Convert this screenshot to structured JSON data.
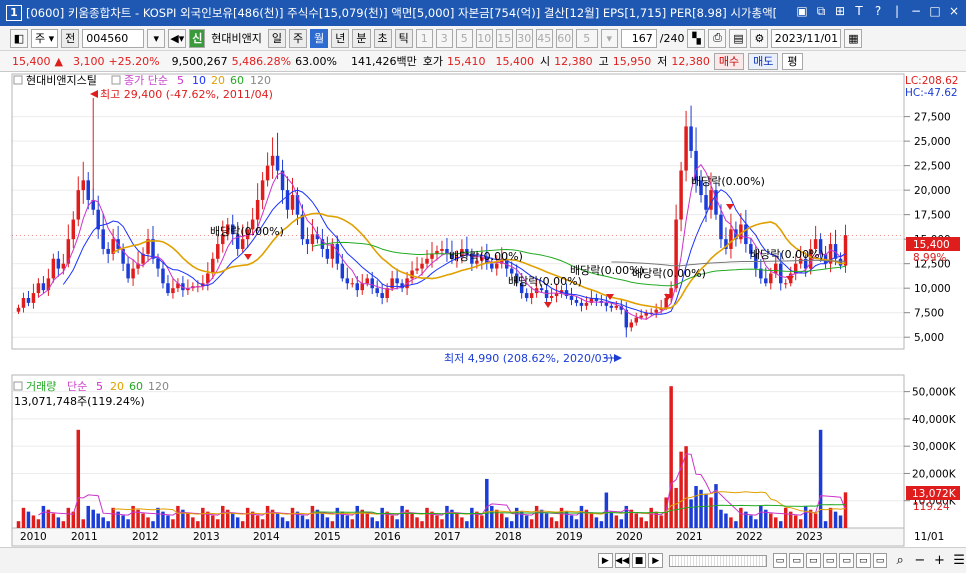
{
  "titlebar": {
    "num": "1",
    "text": "[0600] 키움종합차트 - KOSPI 외국인보유[486(천)] 주식수[15,079(천)] 액면[5,000] 자본금[754(억)] 결산[12월] EPS[1,715] PER[8.98] 시가총액[",
    "controls": [
      "▣",
      "⧉",
      "⊞",
      "T",
      "?",
      "|",
      "−",
      "□",
      "×"
    ]
  },
  "toolbar": {
    "period_label": "주",
    "market_label": "전",
    "code": "004560",
    "stock_name": "현대비앤지",
    "periods": [
      "일",
      "주",
      "월",
      "년",
      "분",
      "초",
      "틱"
    ],
    "selected_period": "월",
    "intervals": [
      "1",
      "3",
      "5",
      "10",
      "15",
      "30",
      "45",
      "60"
    ],
    "interval_value": "5",
    "count": "167",
    "count_total": "/240",
    "date": "2023/11/01"
  },
  "infobar": {
    "price": "15,400",
    "arrow": "▲",
    "change": "3,100",
    "change_pct": "+25.20%",
    "volume": "9,500,267",
    "volume_pct": "5,486.28%",
    "turnover_pct": "63.00%",
    "amount": "141,426백만",
    "ask_label": "호가",
    "ask1": "15,410",
    "ask2": "15,400",
    "open_label": "시",
    "open": "12,380",
    "high_label": "고",
    "high": "15,950",
    "low_label": "저",
    "low": "12,380",
    "buy_label": "매수",
    "sell_label": "매도",
    "eval_label": "평"
  },
  "price_panel": {
    "legend_name": "현대비앤지스틸",
    "legend_items": [
      {
        "text": "종가 단순",
        "color": "#cc44cc"
      },
      {
        "text": "5",
        "color": "#cc33cc"
      },
      {
        "text": "10",
        "color": "#1a33ff"
      },
      {
        "text": "20",
        "color": "#e0a000"
      },
      {
        "text": "60",
        "color": "#22aa22"
      },
      {
        "text": "120",
        "color": "#888888"
      }
    ],
    "high_annotation": "최고 29,400 (-47.62%, 2011/04)",
    "low_annotation": "최저 4,990 (208.62%, 2020/03)",
    "lc_label": "LC:208.62",
    "hc_label": "HC:-47.62",
    "current_price_tag": "15,400",
    "current_pct_tag": "8.99%",
    "dividend_label": "배당락(0.00%)",
    "y_ticks": [
      "27,500",
      "25,000",
      "22,500",
      "20,000",
      "17,500",
      "15,000",
      "12,500",
      "10,000",
      "7,500",
      "5,000"
    ]
  },
  "volume_panel": {
    "legend_items": [
      {
        "text": "거래량",
        "color": "#22aa22"
      },
      {
        "text": "단순",
        "color": "#cc44cc"
      },
      {
        "text": "5",
        "color": "#cc33cc"
      },
      {
        "text": "20",
        "color": "#e0a000"
      },
      {
        "text": "60",
        "color": "#22aa22"
      },
      {
        "text": "120",
        "color": "#888888"
      }
    ],
    "current_volume": "13,071,748주(119.24%)",
    "volume_tag": "13,072K",
    "volume_pct_tag": "119.24",
    "y_ticks": [
      "50,000K",
      "40,000K",
      "30,000K",
      "20,000K",
      "10,000K"
    ]
  },
  "x_axis": {
    "labels": [
      "2010",
      "2011",
      "2012",
      "2013",
      "2014",
      "2015",
      "2016",
      "2017",
      "2018",
      "2019",
      "2020",
      "2021",
      "2022",
      "2023"
    ],
    "right_label": "11/01"
  },
  "colors": {
    "up": "#e01d1d",
    "down": "#1c3cd6",
    "titlebar": "#1f58b3",
    "ma5": "#cc33cc",
    "ma10": "#1a33ff",
    "ma20": "#e0a000",
    "ma60": "#22aa22",
    "ma120": "#777777"
  },
  "chart_data": {
    "type": "candlestick",
    "ohlc_series": [
      {
        "year": 2010,
        "close": [
          8000,
          9000,
          8500,
          9500,
          10500,
          9800,
          11000,
          13000,
          12000,
          12500,
          15000,
          17000
        ]
      },
      {
        "year": 2011,
        "close": [
          20000,
          21000,
          19000,
          18000,
          16000,
          14000,
          13500,
          15000,
          14000,
          12500,
          11000,
          12000
        ]
      },
      {
        "year": 2012,
        "close": [
          12500,
          13500,
          15000,
          13000,
          12000,
          10500,
          9500,
          10000,
          10500,
          9800,
          10000,
          10200
        ]
      },
      {
        "year": 2013,
        "close": [
          10200,
          10500,
          11500,
          13000,
          14500,
          15500,
          16500,
          15500,
          14000,
          15000,
          16000,
          17000
        ]
      },
      {
        "year": 2014,
        "close": [
          19000,
          21000,
          22500,
          23500,
          22000,
          20000,
          18000,
          19500,
          17500,
          15000,
          14500,
          15500
        ]
      },
      {
        "year": 2015,
        "close": [
          15000,
          14000,
          13000,
          14500,
          12500,
          11000,
          10500,
          10500,
          9800,
          10500,
          11000,
          10000
        ]
      },
      {
        "year": 2016,
        "close": [
          9500,
          9000,
          10000,
          11000,
          10500,
          10000,
          11000,
          11800,
          12000,
          12500,
          13000,
          13500
        ]
      },
      {
        "year": 2017,
        "close": [
          13800,
          14000,
          13500,
          13000,
          13200,
          14000,
          13500,
          12500,
          12800,
          13200,
          12500,
          12000
        ]
      },
      {
        "year": 2018,
        "close": [
          12500,
          13000,
          12000,
          11500,
          10500,
          9500,
          9000,
          9500,
          10000,
          9800,
          9000,
          9200
        ]
      },
      {
        "year": 2019,
        "close": [
          9500,
          9800,
          9200,
          8800,
          8500,
          8200,
          8500,
          9000,
          8700,
          8500,
          8200,
          8000
        ]
      },
      {
        "year": 2020,
        "close": [
          8200,
          7800,
          6000,
          6500,
          7000,
          7200,
          7500,
          7500,
          7800,
          8000,
          9000,
          10000
        ]
      },
      {
        "year": 2021,
        "close": [
          17000,
          22000,
          26500,
          24000,
          21000,
          19500,
          18000,
          20000,
          17500,
          15000,
          14000,
          16000
        ]
      },
      {
        "year": 2022,
        "close": [
          15000,
          16500,
          14500,
          13500,
          12000,
          11000,
          10500,
          11500,
          12500,
          10500,
          10500,
          11500
        ]
      },
      {
        "year": 2023,
        "close": [
          12500,
          13000,
          12000,
          14000,
          15000,
          13500,
          12500,
          14500,
          13000,
          12300,
          15400
        ]
      }
    ],
    "y_range": [
      4000,
      29400
    ],
    "volume_range_k": [
      0,
      55000
    ],
    "moving_averages": [
      5,
      10,
      20,
      60,
      120
    ]
  }
}
